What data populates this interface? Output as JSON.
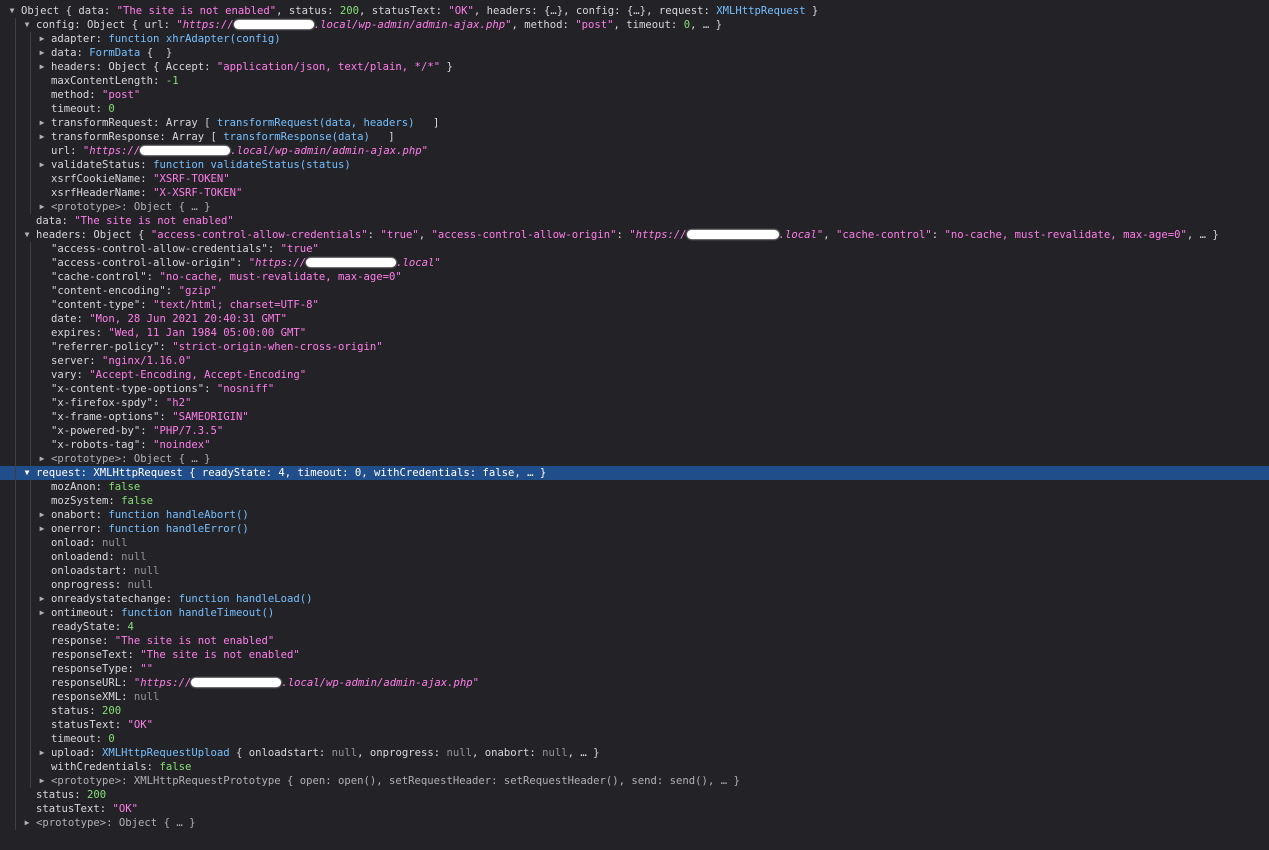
{
  "console": {
    "rows": [
      {
        "depth": 0,
        "tw": "open",
        "parts": [
          [
            "Object { data: ",
            "p"
          ],
          [
            "\"The site is not enabled\"",
            "s"
          ],
          [
            ", status: ",
            "p"
          ],
          [
            "200",
            "n"
          ],
          [
            ", statusText: ",
            "p"
          ],
          [
            "\"OK\"",
            "s"
          ],
          [
            ", headers: {…}, config: {…}, request: ",
            "p"
          ],
          [
            "XMLHttpRequest",
            "kw"
          ],
          [
            " }",
            "p"
          ]
        ]
      },
      {
        "depth": 1,
        "tw": "open",
        "parts": [
          [
            "config: ",
            "k"
          ],
          [
            "Object { url: ",
            "p"
          ],
          [
            "\"https://",
            "si"
          ],
          [
            "R",
            "redact"
          ],
          [
            ".local/wp-admin/admin-ajax.php\"",
            "si"
          ],
          [
            ", method: ",
            "p"
          ],
          [
            "\"post\"",
            "s"
          ],
          [
            ", timeout: ",
            "p"
          ],
          [
            "0",
            "n"
          ],
          [
            ", … }",
            "p"
          ]
        ]
      },
      {
        "depth": 2,
        "tw": "closed",
        "parts": [
          [
            "adapter: ",
            "k"
          ],
          [
            "function ",
            "kw"
          ],
          [
            "xhrAdapter(config)",
            "f"
          ],
          [
            "F",
            "fl"
          ]
        ]
      },
      {
        "depth": 2,
        "tw": "closed",
        "parts": [
          [
            "data: ",
            "k"
          ],
          [
            "FormData",
            "kw"
          ],
          [
            " {  }",
            "p"
          ]
        ]
      },
      {
        "depth": 2,
        "tw": "closed",
        "parts": [
          [
            "headers: ",
            "k"
          ],
          [
            "Object { Accept: ",
            "p"
          ],
          [
            "\"application/json, text/plain, */*\"",
            "s"
          ],
          [
            " }",
            "p"
          ]
        ]
      },
      {
        "depth": 2,
        "tw": "none",
        "parts": [
          [
            "maxContentLength: ",
            "k"
          ],
          [
            "-1",
            "n"
          ]
        ]
      },
      {
        "depth": 2,
        "tw": "none",
        "parts": [
          [
            "method: ",
            "k"
          ],
          [
            "\"post\"",
            "s"
          ]
        ]
      },
      {
        "depth": 2,
        "tw": "none",
        "parts": [
          [
            "timeout: ",
            "k"
          ],
          [
            "0",
            "n"
          ]
        ]
      },
      {
        "depth": 2,
        "tw": "closed",
        "parts": [
          [
            "transformRequest: ",
            "k"
          ],
          [
            "Array [ ",
            "p"
          ],
          [
            "transformRequest(data, headers)",
            "f"
          ],
          [
            "F",
            "fl"
          ],
          [
            " ]",
            "p"
          ]
        ]
      },
      {
        "depth": 2,
        "tw": "closed",
        "parts": [
          [
            "transformResponse: ",
            "k"
          ],
          [
            "Array [ ",
            "p"
          ],
          [
            "transformResponse(data)",
            "f"
          ],
          [
            "F",
            "fl"
          ],
          [
            " ]",
            "p"
          ]
        ]
      },
      {
        "depth": 2,
        "tw": "none",
        "parts": [
          [
            "url: ",
            "k"
          ],
          [
            "\"https://",
            "si"
          ],
          [
            "R",
            "redact"
          ],
          [
            ".local/wp-admin/admin-ajax.php\"",
            "si"
          ]
        ]
      },
      {
        "depth": 2,
        "tw": "closed",
        "parts": [
          [
            "validateStatus: ",
            "k"
          ],
          [
            "function ",
            "kw"
          ],
          [
            "validateStatus(status)",
            "f"
          ],
          [
            "F",
            "fl"
          ]
        ]
      },
      {
        "depth": 2,
        "tw": "none",
        "parts": [
          [
            "xsrfCookieName: ",
            "k"
          ],
          [
            "\"XSRF-TOKEN\"",
            "s"
          ]
        ]
      },
      {
        "depth": 2,
        "tw": "none",
        "parts": [
          [
            "xsrfHeaderName: ",
            "k"
          ],
          [
            "\"X-XSRF-TOKEN\"",
            "s"
          ]
        ]
      },
      {
        "depth": 2,
        "tw": "closed",
        "parts": [
          [
            "<prototype>: ",
            "g"
          ],
          [
            "Object { … }",
            "g"
          ]
        ]
      },
      {
        "depth": 1,
        "tw": "none",
        "parts": [
          [
            "data: ",
            "k"
          ],
          [
            "\"The site is not enabled\"",
            "s"
          ]
        ]
      },
      {
        "depth": 1,
        "tw": "open",
        "parts": [
          [
            "headers: ",
            "k"
          ],
          [
            "Object { ",
            "p"
          ],
          [
            "\"access-control-allow-credentials\"",
            "s"
          ],
          [
            ": ",
            "p"
          ],
          [
            "\"true\"",
            "s"
          ],
          [
            ", ",
            "p"
          ],
          [
            "\"access-control-allow-origin\"",
            "s"
          ],
          [
            ": ",
            "p"
          ],
          [
            "\"https://",
            "si"
          ],
          [
            "R",
            "redact"
          ],
          [
            ".local\"",
            "si"
          ],
          [
            ", ",
            "p"
          ],
          [
            "\"cache-control\"",
            "s"
          ],
          [
            ": ",
            "p"
          ],
          [
            "\"no-cache, must-revalidate, max-age=0\"",
            "s"
          ],
          [
            ", … }",
            "p"
          ]
        ]
      },
      {
        "depth": 2,
        "tw": "none",
        "parts": [
          [
            "\"access-control-allow-credentials\": ",
            "k"
          ],
          [
            "\"true\"",
            "s"
          ]
        ]
      },
      {
        "depth": 2,
        "tw": "none",
        "parts": [
          [
            "\"access-control-allow-origin\": ",
            "k"
          ],
          [
            "\"https://",
            "si"
          ],
          [
            "R",
            "redact"
          ],
          [
            ".local\"",
            "si"
          ]
        ]
      },
      {
        "depth": 2,
        "tw": "none",
        "parts": [
          [
            "\"cache-control\": ",
            "k"
          ],
          [
            "\"no-cache, must-revalidate, max-age=0\"",
            "s"
          ]
        ]
      },
      {
        "depth": 2,
        "tw": "none",
        "parts": [
          [
            "\"content-encoding\": ",
            "k"
          ],
          [
            "\"gzip\"",
            "s"
          ]
        ]
      },
      {
        "depth": 2,
        "tw": "none",
        "parts": [
          [
            "\"content-type\": ",
            "k"
          ],
          [
            "\"text/html; charset=UTF-8\"",
            "s"
          ]
        ]
      },
      {
        "depth": 2,
        "tw": "none",
        "parts": [
          [
            "date: ",
            "k"
          ],
          [
            "\"Mon, 28 Jun 2021 20:40:31 GMT\"",
            "s"
          ]
        ]
      },
      {
        "depth": 2,
        "tw": "none",
        "parts": [
          [
            "expires: ",
            "k"
          ],
          [
            "\"Wed, 11 Jan 1984 05:00:00 GMT\"",
            "s"
          ]
        ]
      },
      {
        "depth": 2,
        "tw": "none",
        "parts": [
          [
            "\"referrer-policy\": ",
            "k"
          ],
          [
            "\"strict-origin-when-cross-origin\"",
            "s"
          ]
        ]
      },
      {
        "depth": 2,
        "tw": "none",
        "parts": [
          [
            "server: ",
            "k"
          ],
          [
            "\"nginx/1.16.0\"",
            "s"
          ]
        ]
      },
      {
        "depth": 2,
        "tw": "none",
        "parts": [
          [
            "vary: ",
            "k"
          ],
          [
            "\"Accept-Encoding, Accept-Encoding\"",
            "s"
          ]
        ]
      },
      {
        "depth": 2,
        "tw": "none",
        "parts": [
          [
            "\"x-content-type-options\": ",
            "k"
          ],
          [
            "\"nosniff\"",
            "s"
          ]
        ]
      },
      {
        "depth": 2,
        "tw": "none",
        "parts": [
          [
            "\"x-firefox-spdy\": ",
            "k"
          ],
          [
            "\"h2\"",
            "s"
          ]
        ]
      },
      {
        "depth": 2,
        "tw": "none",
        "parts": [
          [
            "\"x-frame-options\": ",
            "k"
          ],
          [
            "\"SAMEORIGIN\"",
            "s"
          ]
        ]
      },
      {
        "depth": 2,
        "tw": "none",
        "parts": [
          [
            "\"x-powered-by\": ",
            "k"
          ],
          [
            "\"PHP/7.3.5\"",
            "s"
          ]
        ]
      },
      {
        "depth": 2,
        "tw": "none",
        "parts": [
          [
            "\"x-robots-tag\": ",
            "k"
          ],
          [
            "\"noindex\"",
            "s"
          ]
        ]
      },
      {
        "depth": 2,
        "tw": "closed",
        "parts": [
          [
            "<prototype>: ",
            "g"
          ],
          [
            "Object { … }",
            "g"
          ]
        ]
      },
      {
        "depth": 1,
        "tw": "open",
        "sel": true,
        "parts": [
          [
            "request: ",
            "k"
          ],
          [
            "XMLHttpRequest { readyState: 4, timeout: 0, withCredentials: false, … }",
            "p"
          ]
        ]
      },
      {
        "depth": 2,
        "tw": "none",
        "parts": [
          [
            "mozAnon: ",
            "k"
          ],
          [
            "false",
            "n"
          ]
        ]
      },
      {
        "depth": 2,
        "tw": "none",
        "parts": [
          [
            "mozSystem: ",
            "k"
          ],
          [
            "false",
            "n"
          ]
        ]
      },
      {
        "depth": 2,
        "tw": "closed",
        "parts": [
          [
            "onabort: ",
            "k"
          ],
          [
            "function ",
            "kw"
          ],
          [
            "handleAbort()",
            "f"
          ],
          [
            "F",
            "fl"
          ]
        ]
      },
      {
        "depth": 2,
        "tw": "closed",
        "parts": [
          [
            "onerror: ",
            "k"
          ],
          [
            "function ",
            "kw"
          ],
          [
            "handleError()",
            "f"
          ],
          [
            "F",
            "fl"
          ]
        ]
      },
      {
        "depth": 2,
        "tw": "none",
        "parts": [
          [
            "onload: ",
            "k"
          ],
          [
            "null",
            "nl"
          ]
        ]
      },
      {
        "depth": 2,
        "tw": "none",
        "parts": [
          [
            "onloadend: ",
            "k"
          ],
          [
            "null",
            "nl"
          ]
        ]
      },
      {
        "depth": 2,
        "tw": "none",
        "parts": [
          [
            "onloadstart: ",
            "k"
          ],
          [
            "null",
            "nl"
          ]
        ]
      },
      {
        "depth": 2,
        "tw": "none",
        "parts": [
          [
            "onprogress: ",
            "k"
          ],
          [
            "null",
            "nl"
          ]
        ]
      },
      {
        "depth": 2,
        "tw": "closed",
        "parts": [
          [
            "onreadystatechange: ",
            "k"
          ],
          [
            "function ",
            "kw"
          ],
          [
            "handleLoad()",
            "f"
          ],
          [
            "F",
            "fl"
          ]
        ]
      },
      {
        "depth": 2,
        "tw": "closed",
        "parts": [
          [
            "ontimeout: ",
            "k"
          ],
          [
            "function ",
            "kw"
          ],
          [
            "handleTimeout()",
            "f"
          ],
          [
            "F",
            "fl"
          ]
        ]
      },
      {
        "depth": 2,
        "tw": "none",
        "parts": [
          [
            "readyState: ",
            "k"
          ],
          [
            "4",
            "n"
          ]
        ]
      },
      {
        "depth": 2,
        "tw": "none",
        "parts": [
          [
            "response: ",
            "k"
          ],
          [
            "\"The site is not enabled\"",
            "s"
          ]
        ]
      },
      {
        "depth": 2,
        "tw": "none",
        "parts": [
          [
            "responseText: ",
            "k"
          ],
          [
            "\"The site is not enabled\"",
            "s"
          ]
        ]
      },
      {
        "depth": 2,
        "tw": "none",
        "parts": [
          [
            "responseType: ",
            "k"
          ],
          [
            "\"\"",
            "s"
          ]
        ]
      },
      {
        "depth": 2,
        "tw": "none",
        "parts": [
          [
            "responseURL: ",
            "k"
          ],
          [
            "\"https://",
            "si"
          ],
          [
            "R",
            "redact"
          ],
          [
            ".local/wp-admin/admin-ajax.php\"",
            "si"
          ]
        ]
      },
      {
        "depth": 2,
        "tw": "none",
        "parts": [
          [
            "responseXML: ",
            "k"
          ],
          [
            "null",
            "nl"
          ]
        ]
      },
      {
        "depth": 2,
        "tw": "none",
        "parts": [
          [
            "status: ",
            "k"
          ],
          [
            "200",
            "n"
          ]
        ]
      },
      {
        "depth": 2,
        "tw": "none",
        "parts": [
          [
            "statusText: ",
            "k"
          ],
          [
            "\"OK\"",
            "s"
          ]
        ]
      },
      {
        "depth": 2,
        "tw": "none",
        "parts": [
          [
            "timeout: ",
            "k"
          ],
          [
            "0",
            "n"
          ]
        ]
      },
      {
        "depth": 2,
        "tw": "closed",
        "parts": [
          [
            "upload: ",
            "k"
          ],
          [
            "XMLHttpRequestUpload",
            "kw"
          ],
          [
            " { onloadstart: ",
            "p"
          ],
          [
            "null",
            "nl"
          ],
          [
            ", onprogress: ",
            "p"
          ],
          [
            "null",
            "nl"
          ],
          [
            ", onabort: ",
            "p"
          ],
          [
            "null",
            "nl"
          ],
          [
            ", … }",
            "p"
          ]
        ]
      },
      {
        "depth": 2,
        "tw": "none",
        "parts": [
          [
            "withCredentials: ",
            "k"
          ],
          [
            "false",
            "n"
          ]
        ]
      },
      {
        "depth": 2,
        "tw": "closed",
        "parts": [
          [
            "<prototype>: ",
            "g"
          ],
          [
            "XMLHttpRequestPrototype { open: open(), setRequestHeader: setRequestHeader(), send: send(), … }",
            "g"
          ]
        ]
      },
      {
        "depth": 1,
        "tw": "none",
        "parts": [
          [
            "status: ",
            "k"
          ],
          [
            "200",
            "n"
          ]
        ]
      },
      {
        "depth": 1,
        "tw": "none",
        "parts": [
          [
            "statusText: ",
            "k"
          ],
          [
            "\"OK\"",
            "s"
          ]
        ]
      },
      {
        "depth": 1,
        "tw": "closed",
        "parts": [
          [
            "<prototype>: ",
            "g"
          ],
          [
            "Object { … }",
            "g"
          ]
        ]
      }
    ]
  }
}
